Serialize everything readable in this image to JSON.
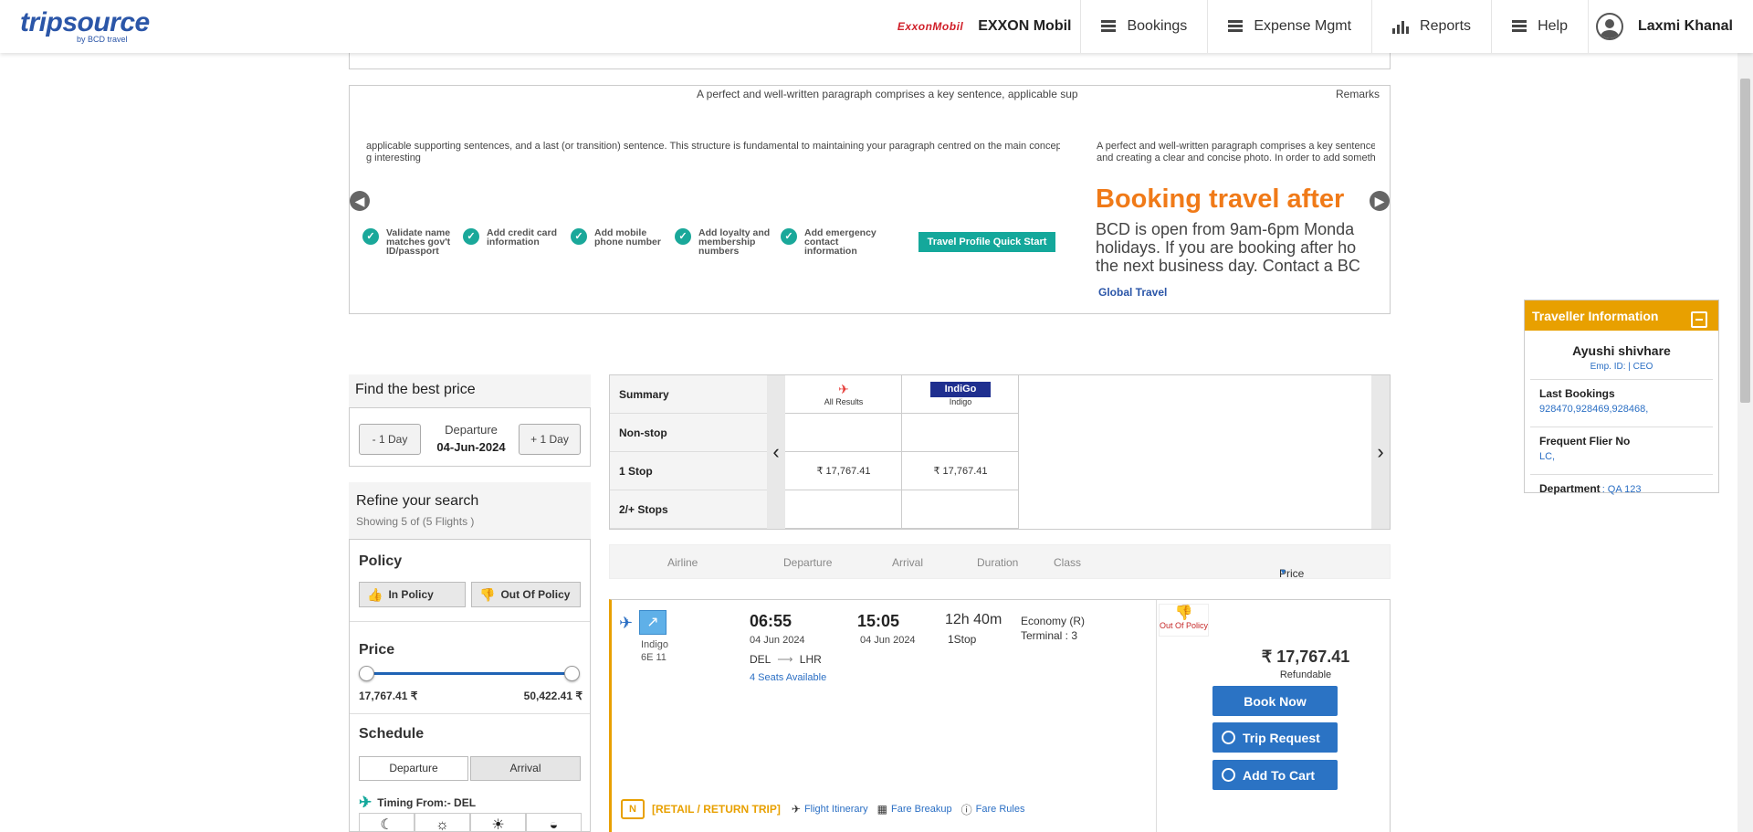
{
  "header": {
    "logo_text": "tripsource",
    "logo_by": "by BCD travel",
    "company_logo": "ExxonMobil",
    "company_name": "EXXON Mobil",
    "nav": [
      {
        "label": "Bookings",
        "icon": "menu-icon"
      },
      {
        "label": "Expense Mgmt",
        "icon": "menu-icon"
      },
      {
        "label": "Reports",
        "icon": "bar-chart-icon"
      },
      {
        "label": "Help",
        "icon": "menu-icon"
      }
    ],
    "user_name": "Laxmi Khanal"
  },
  "carousel": {
    "line1": "A perfect and well-written paragraph comprises a key sentence, applicable sup",
    "remarks": "Remarks",
    "para_left": "applicable supporting sentences, and a last (or transition) sentence. This structure is fundamental to maintaining your paragraph centred on the main concept",
    "para_left2": "g interesting",
    "para_right": "A perfect and well-written paragraph comprises a key sentence,",
    "para_right2": "and creating a clear and concise photo. In order to add somethir",
    "steps": [
      "Validate name matches gov't ID/passport",
      "Add credit card information",
      "Add mobile phone number",
      "Add loyalty and membership numbers",
      "Add emergency contact information"
    ],
    "quick_start": "Travel Profile Quick Start",
    "bcd_title": "Booking travel after",
    "bcd_lines": [
      "BCD is open from 9am-6pm Monda",
      "holidays. If you are booking after ho",
      "the next business day. Contact a BC"
    ],
    "global_travel": "Global Travel"
  },
  "find_price": {
    "title": "Find the best price",
    "minus_day": "- 1 Day",
    "plus_day": "+ 1 Day",
    "departure_label": "Departure",
    "departure_date": "04-Jun-2024"
  },
  "refine": {
    "title": "Refine your search",
    "subtitle": "Showing 5 of (5 Flights )",
    "policy_title": "Policy",
    "in_policy": "In Policy",
    "out_policy": "Out Of Policy",
    "price_title": "Price",
    "price_min": "17,767.41 ₹",
    "price_max": "50,422.41 ₹",
    "price_range_fraction": [
      0,
      1
    ],
    "schedule_title": "Schedule",
    "tab_departure": "Departure",
    "tab_arrival": "Arrival",
    "timing_label": "Timing From:- DEL",
    "time_slots": [
      "☾",
      "☼",
      "☀",
      "◒"
    ]
  },
  "matrix": {
    "rows": [
      "Summary",
      "Non-stop",
      "1 Stop",
      "2/+ Stops"
    ],
    "columns": [
      {
        "name": "All Results",
        "non_stop": "",
        "one_stop": "₹ 17,767.41",
        "two_stop": ""
      },
      {
        "name": "Indigo",
        "logo": "IndiGo",
        "non_stop": "",
        "one_stop": "₹ 17,767.41",
        "two_stop": ""
      }
    ]
  },
  "results_header": {
    "airline": "Airline",
    "departure": "Departure",
    "arrival": "Arrival",
    "duration": "Duration",
    "class": "Class",
    "price": "Price"
  },
  "flight": {
    "airline": "Indigo",
    "flight_no": "6E  11",
    "dep_time": "06:55",
    "dep_date": "04 Jun 2024",
    "arr_time": "15:05",
    "arr_date": "04 Jun 2024",
    "from": "DEL",
    "to": "LHR",
    "seats": "4 Seats Available",
    "duration": "12h 40m",
    "stops": "1Stop",
    "class": "Economy (R)",
    "terminal": "Terminal : 3",
    "policy": "Out Of Policy",
    "price": "₹ 17,767.41",
    "refundable": "Refundable",
    "book_now": "Book Now",
    "trip_request": "Trip Request",
    "add_to_cart": "Add To Cart",
    "trip_type": "[RETAIL / RETURN TRIP]",
    "bag_label": "N",
    "itinerary": "Flight Itinerary",
    "fare_breakup": "Fare Breakup",
    "fare_rules": "Fare Rules"
  },
  "traveller": {
    "title": "Traveller Information",
    "name": "Ayushi shivhare",
    "emp": "Emp. ID: | CEO",
    "last_bookings_label": "Last Bookings",
    "last_bookings": "928470,928469,928468,",
    "ff_label": "Frequent Flier No",
    "ff_value": "LC,",
    "dept_label": "Department",
    "dept_value": ": QA 123"
  },
  "colors": {
    "brand_blue": "#2b73c4",
    "accent_orange": "#e8a000",
    "teal": "#14a89b",
    "danger": "#c62828"
  }
}
